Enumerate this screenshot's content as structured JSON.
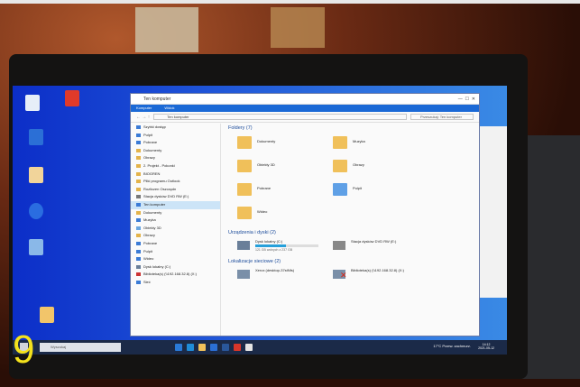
{
  "window": {
    "title": "Ten komputer",
    "ribbon_tabs": [
      "Komputer",
      "Widok"
    ],
    "address": "Ten komputer",
    "search_placeholder": "Przeszukaj: Ten komputer"
  },
  "nav_pane": {
    "items": [
      {
        "label": "Szybki dostęp",
        "selected": false
      },
      {
        "label": "Pulpit",
        "selected": false
      },
      {
        "label": "Pobrane",
        "selected": false
      },
      {
        "label": "Dokumenty",
        "selected": false
      },
      {
        "label": "Obrazy",
        "selected": false
      },
      {
        "label": "2. Projekt - Pokonki",
        "selected": false
      },
      {
        "label": "BIOGREN",
        "selected": false
      },
      {
        "label": "Pliki programu Outlook",
        "selected": false
      },
      {
        "label": "Rozliczen Oszczędn",
        "selected": false
      },
      {
        "label": "Stacja dysków DVD RW (E:)",
        "selected": false
      },
      {
        "label": "Ten komputer",
        "selected": true
      },
      {
        "label": "Dokumenty",
        "selected": false
      },
      {
        "label": "Muzyka",
        "selected": false
      },
      {
        "label": "Obiekty 3D",
        "selected": false
      },
      {
        "label": "Obrazy",
        "selected": false
      },
      {
        "label": "Pobrane",
        "selected": false
      },
      {
        "label": "Pulpit",
        "selected": false
      },
      {
        "label": "Wideo",
        "selected": false
      },
      {
        "label": "Dysk lokalny (C:)",
        "selected": false
      },
      {
        "label": "Biblioteka(s) (\\\\192.168.32.8) (X:)",
        "selected": false
      },
      {
        "label": "Sieć",
        "selected": false
      }
    ]
  },
  "content": {
    "folders_header": "Foldery (7)",
    "folders": [
      "Dokumenty",
      "Muzyka",
      "Obiekty 3D",
      "Obrazy",
      "Pobrane",
      "Pulpit",
      "Wideo"
    ],
    "devices_header": "Urządzenia i dyski (2)",
    "devices": [
      {
        "label": "Dysk lokalny (C:)",
        "free": "121 GB wolnych z 237 GB",
        "used_fraction": 0.49
      },
      {
        "label": "Stacja dysków DVD RW (E:)"
      }
    ],
    "network_header": "Lokalizacje sieciowe (2)",
    "network": [
      "Xerox (desktop-37stNfs)",
      "Biblioteka(s) (\\\\192.168.32.8) (X:)"
    ]
  },
  "taskbar": {
    "search_placeholder": "Wyszukaj",
    "tray_text": "17°C Przew. zachmurz.",
    "clock_time": "14:12",
    "clock_date": "2021-05-12"
  },
  "overlay_number": "9",
  "colors": {
    "desktop": "#1f55d8",
    "ribbon": "#1b69d6",
    "taskbar": "#1b2a48",
    "overlay": "#f4e21c"
  }
}
